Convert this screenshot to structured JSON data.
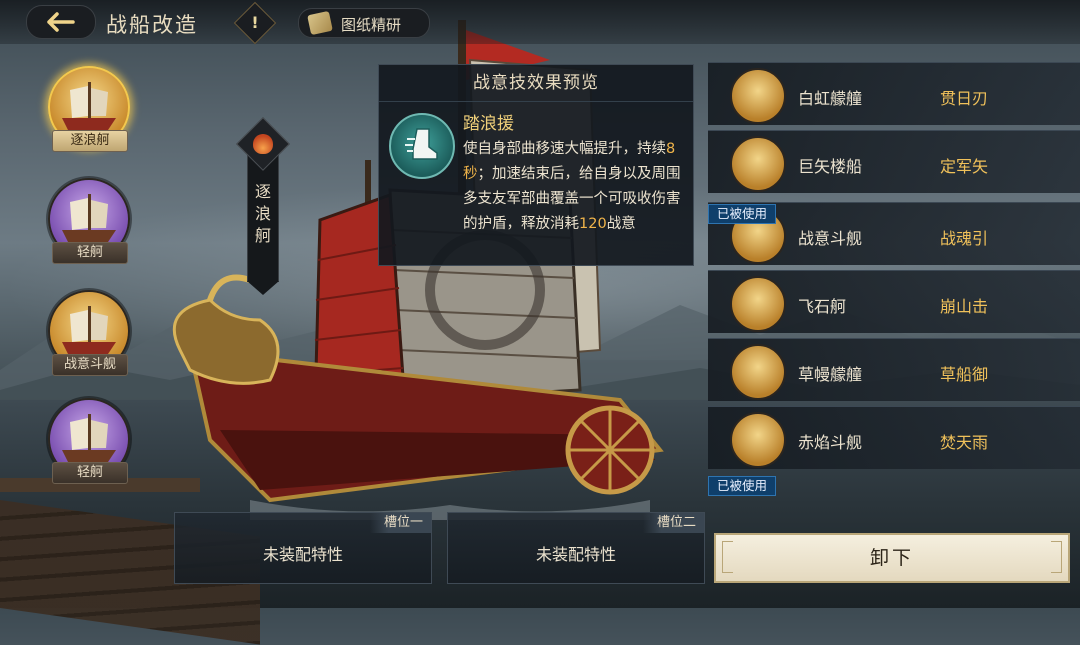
{
  "header": {
    "title": "战船改造",
    "info_symbol": "!",
    "blueprint_label": "图纸精研"
  },
  "ship_list": [
    {
      "name": "逐浪舸",
      "rarity": "gold",
      "selected": true
    },
    {
      "name": "轻舸",
      "rarity": "purple",
      "selected": false
    },
    {
      "name": "战意斗舰",
      "rarity": "gold",
      "selected": false
    },
    {
      "name": "轻舸",
      "rarity": "purple",
      "selected": false
    }
  ],
  "current_ship": {
    "vertical_label": "逐浪舸"
  },
  "preview": {
    "title": "战意技效果预览",
    "skill_name": "踏浪援",
    "description_parts": [
      "使自身部曲移速大幅提升，持续",
      "8秒",
      "；加速结束后，给自身以及周围多支友军部曲覆盖一个可吸收伤害的护盾，释放消耗",
      "120",
      "战意"
    ]
  },
  "slot_list": [
    {
      "ship": "白虹艨艟",
      "skill": "贯日刃",
      "used": false
    },
    {
      "ship": "巨矢楼船",
      "skill": "定军矢",
      "used": false
    },
    {
      "ship": "战意斗舰",
      "skill": "战魂引",
      "used": true
    },
    {
      "ship": "飞石舸",
      "skill": "崩山击",
      "used": false
    },
    {
      "ship": "草幔艨艟",
      "skill": "草船御",
      "used": false
    },
    {
      "ship": "赤焰斗舰",
      "skill": "焚天雨",
      "used": false
    }
  ],
  "used_label": "已被使用",
  "slots": [
    {
      "tag": "槽位一",
      "state": "未装配特性"
    },
    {
      "tag": "槽位二",
      "state": "未装配特性"
    }
  ],
  "unload_label": "卸下",
  "colors": {
    "gold_accent": "#f0c15a",
    "used_badge": "#0f3f6b",
    "button_bg": "#f0e8d4"
  },
  "icons": [
    "back-arrow-icon",
    "exclamation-icon",
    "scroll-icon",
    "flame-ship-icon",
    "boot-wind-icon"
  ]
}
